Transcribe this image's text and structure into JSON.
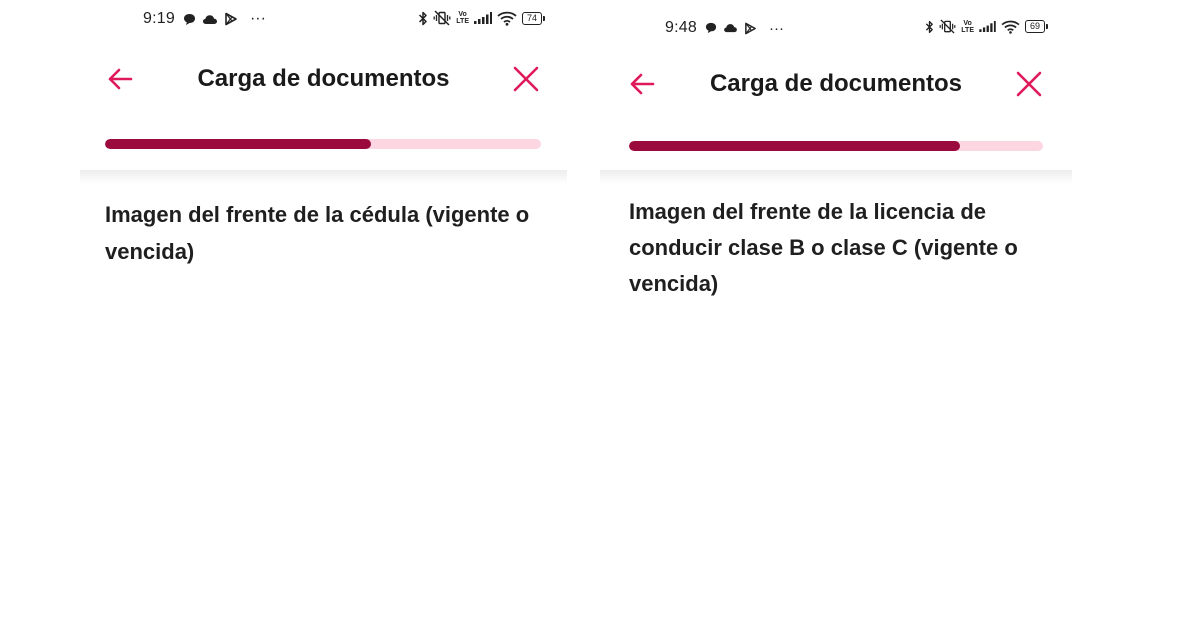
{
  "screens": [
    {
      "status_bar": {
        "time": "9:19",
        "left_icons": [
          "chat-bubble-icon",
          "cloud-icon",
          "play-store-icon",
          "more-dots-icon"
        ],
        "more": "···",
        "right_icons": [
          "bluetooth-icon",
          "vibrate-off-icon",
          "volte-icon",
          "signal-icon",
          "wifi-icon",
          "battery-icon"
        ],
        "volte_top": "Vo",
        "volte_bottom": "LTE",
        "battery": "74"
      },
      "app_bar": {
        "title": "Carga de documentos",
        "back_icon": "arrow-left-icon",
        "close_icon": "close-icon"
      },
      "progress": 0.61,
      "document_title": "Imagen del frente de la cédula (vigente o vencida)"
    },
    {
      "status_bar": {
        "time": "9:48",
        "left_icons": [
          "chat-bubble-icon",
          "cloud-icon",
          "play-store-icon",
          "more-dots-icon"
        ],
        "more": "···",
        "right_icons": [
          "bluetooth-icon",
          "vibrate-off-icon",
          "volte-icon",
          "signal-icon",
          "wifi-icon",
          "battery-icon"
        ],
        "volte_top": "Vo",
        "volte_bottom": "LTE",
        "battery": "69"
      },
      "app_bar": {
        "title": "Carga de documentos",
        "back_icon": "arrow-left-icon",
        "close_icon": "close-icon"
      },
      "progress": 0.8,
      "document_title": "Imagen del frente de la licencia de conducir clase B o clase C (vigente o vencida)"
    }
  ],
  "colors": {
    "accent": "#e0195a",
    "progress_fill": "#9a0a3c",
    "progress_track": "#fcd6e1",
    "text": "#1a1a1a"
  }
}
